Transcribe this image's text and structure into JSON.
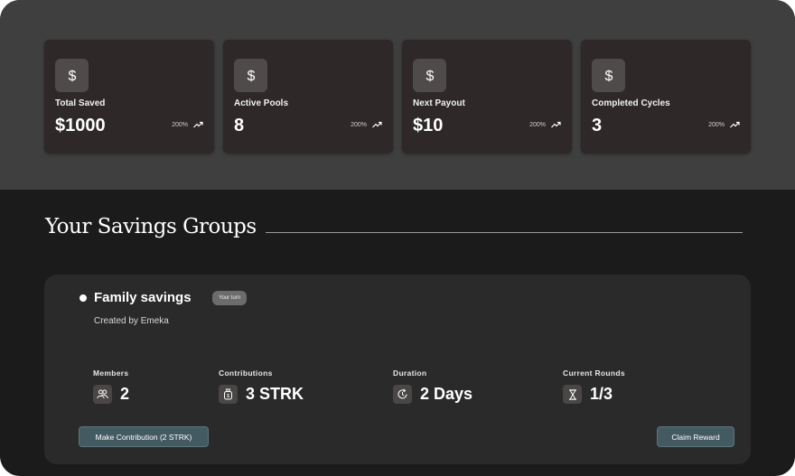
{
  "stats": [
    {
      "label": "Total Saved",
      "value": "$1000",
      "trend": "200%",
      "icon": "dollar-icon"
    },
    {
      "label": "Active Pools",
      "value": "8",
      "trend": "200%",
      "icon": "dollar-icon"
    },
    {
      "label": "Next Payout",
      "value": "$10",
      "trend": "200%",
      "icon": "dollar-icon"
    },
    {
      "label": "Completed Cycles",
      "value": "3",
      "trend": "200%",
      "icon": "dollar-icon"
    }
  ],
  "section": {
    "title": "Your Savings Groups"
  },
  "group": {
    "name": "Family savings",
    "badge": "Your turn",
    "creator": "Created by Emeka",
    "meta": [
      {
        "label": "Members",
        "value": "2",
        "icon": "members-icon"
      },
      {
        "label": "Contributions",
        "value": "3 STRK",
        "icon": "wallet-icon"
      },
      {
        "label": "Duration",
        "value": "2 Days",
        "icon": "clock-icon"
      },
      {
        "label": "Current Rounds",
        "value": "1/3",
        "icon": "hourglass-icon"
      }
    ],
    "contribute_label": "Make Contribution (2 STRK)",
    "claim_label": "Claim Reward"
  },
  "colors": {
    "accent_button": "#445a62",
    "top_band": "#3f3f3f",
    "card": "#2e2828",
    "page": "#1b1b1b"
  }
}
